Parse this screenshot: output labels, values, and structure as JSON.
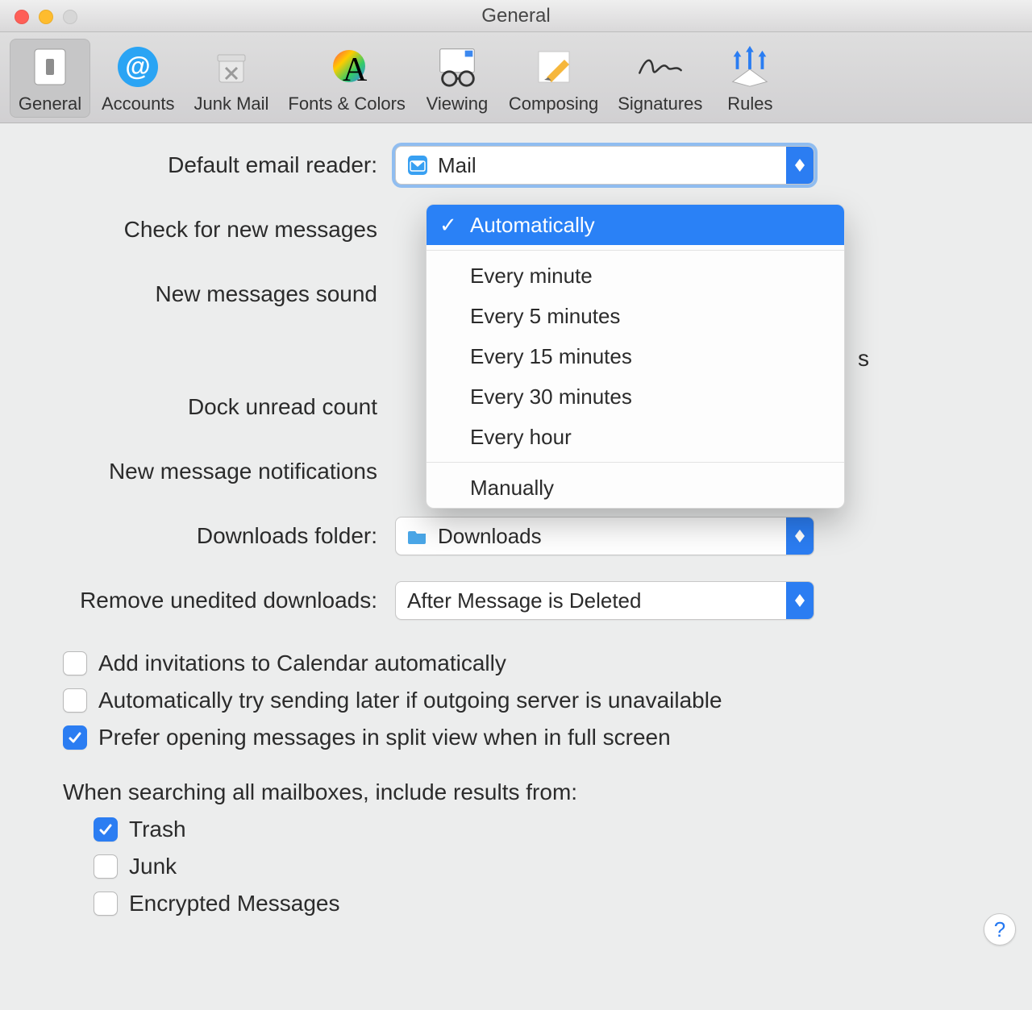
{
  "window": {
    "title": "General"
  },
  "toolbar": {
    "items": [
      {
        "label": "General"
      },
      {
        "label": "Accounts"
      },
      {
        "label": "Junk Mail"
      },
      {
        "label": "Fonts & Colors"
      },
      {
        "label": "Viewing"
      },
      {
        "label": "Composing"
      },
      {
        "label": "Signatures"
      },
      {
        "label": "Rules"
      }
    ]
  },
  "form": {
    "defaultReader": {
      "label": "Default email reader:",
      "value": "Mail"
    },
    "checkMessages": {
      "label": "Check for new messages",
      "selected": "Automatically",
      "options_group1": [
        "Automatically"
      ],
      "options_group2": [
        "Every minute",
        "Every 5 minutes",
        "Every 15 minutes",
        "Every 30 minutes",
        "Every hour"
      ],
      "options_group3": [
        "Manually"
      ]
    },
    "newSound": {
      "label": "New messages sound"
    },
    "trailing_letter": "s",
    "dockUnread": {
      "label": "Dock unread count"
    },
    "notifications": {
      "label": "New message notifications"
    },
    "downloadsFolder": {
      "label": "Downloads folder:",
      "value": "Downloads"
    },
    "removeUnedited": {
      "label": "Remove unedited downloads:",
      "value": "After Message is Deleted"
    }
  },
  "checks": {
    "addInvitations": {
      "label": "Add invitations to Calendar automatically",
      "checked": false
    },
    "autoSendLater": {
      "label": "Automatically try sending later if outgoing server is unavailable",
      "checked": false
    },
    "preferSplit": {
      "label": "Prefer opening messages in split view when in full screen",
      "checked": true
    }
  },
  "searchSection": {
    "label": "When searching all mailboxes, include results from:",
    "trash": {
      "label": "Trash",
      "checked": true
    },
    "junk": {
      "label": "Junk",
      "checked": false
    },
    "encrypted": {
      "label": "Encrypted Messages",
      "checked": false
    }
  },
  "help": {
    "label": "?"
  }
}
